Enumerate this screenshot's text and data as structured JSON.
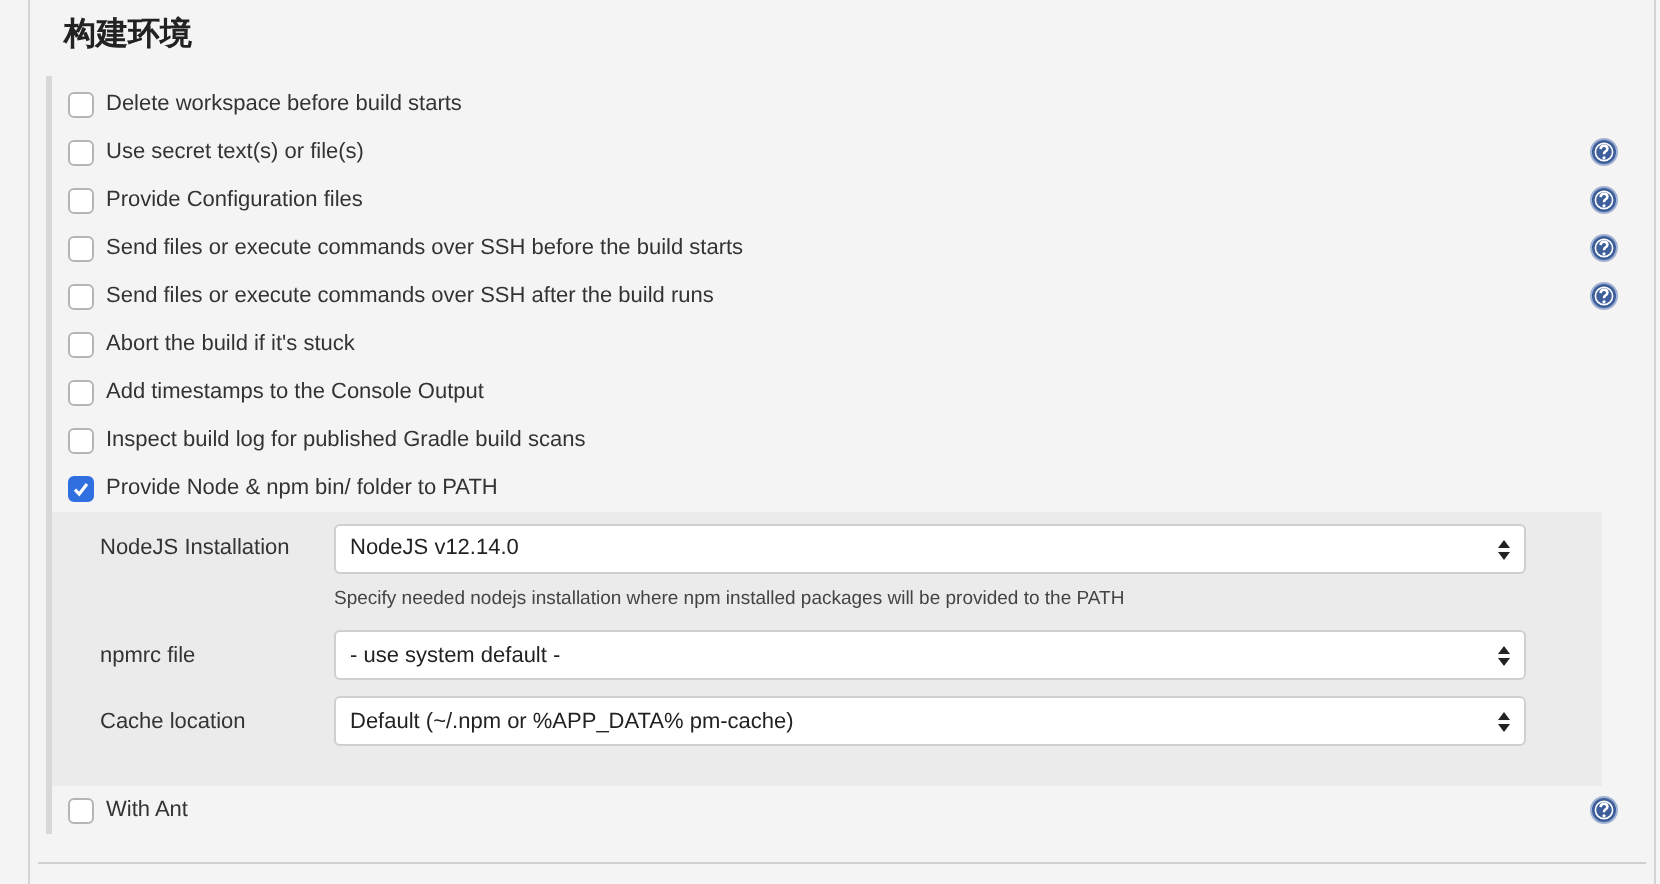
{
  "section": {
    "title": "构建环境"
  },
  "options": [
    {
      "label": "Delete workspace before build starts",
      "checked": false,
      "help": false
    },
    {
      "label": "Use secret text(s) or file(s)",
      "checked": false,
      "help": true
    },
    {
      "label": "Provide Configuration files",
      "checked": false,
      "help": true
    },
    {
      "label": "Send files or execute commands over SSH before the build starts",
      "checked": false,
      "help": true
    },
    {
      "label": "Send files or execute commands over SSH after the build runs",
      "checked": false,
      "help": true
    },
    {
      "label": "Abort the build if it's stuck",
      "checked": false,
      "help": false
    },
    {
      "label": "Add timestamps to the Console Output",
      "checked": false,
      "help": false
    },
    {
      "label": "Inspect build log for published Gradle build scans",
      "checked": false,
      "help": false
    },
    {
      "label": "Provide Node & npm bin/ folder to PATH",
      "checked": true,
      "help": false,
      "fields": [
        {
          "label": "NodeJS Installation",
          "value": "NodeJS v12.14.0",
          "hint": "Specify needed nodejs installation where npm installed packages will be provided to the PATH"
        },
        {
          "label": "npmrc file",
          "value": "- use system default -"
        },
        {
          "label": "Cache location",
          "value": "Default (~/.npm or %APP_DATA% pm-cache)"
        }
      ]
    },
    {
      "label": "With Ant",
      "checked": false,
      "help": true
    }
  ]
}
